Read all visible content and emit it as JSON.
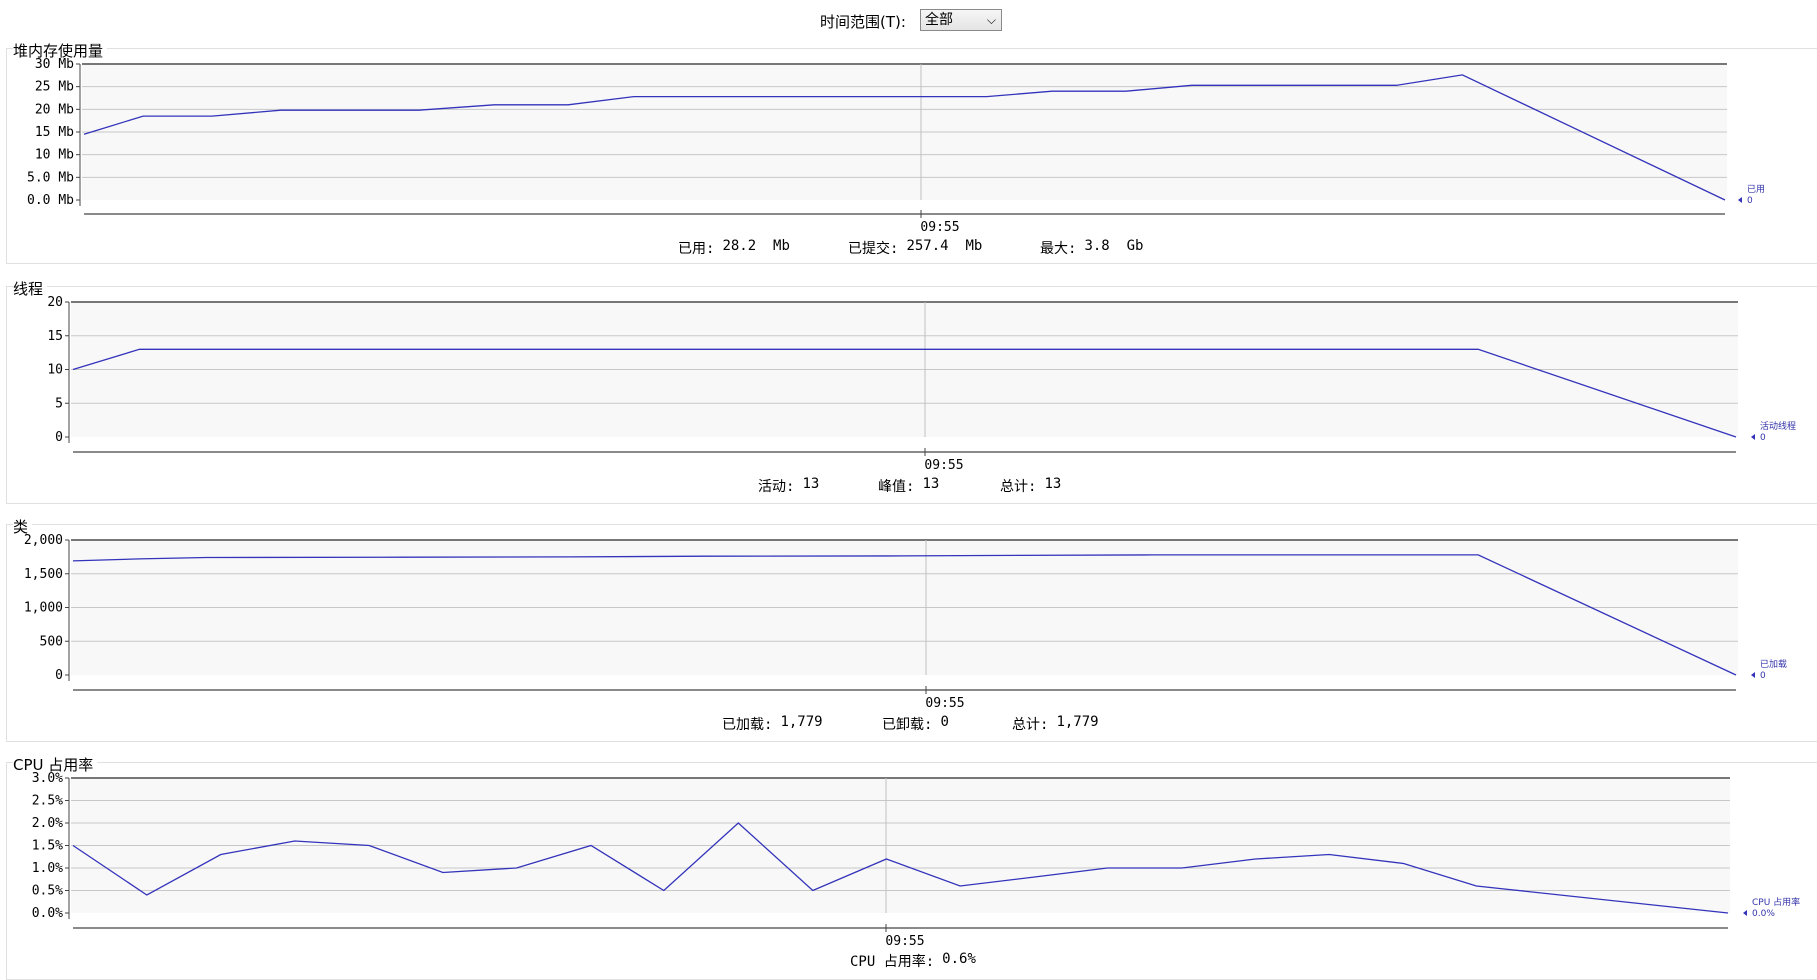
{
  "toolbar": {
    "range_label": "时间范围(T):",
    "range_value": "全部"
  },
  "panels": [
    {
      "title": "堆内存使用量",
      "legend_name": "已用",
      "legend_value": "0",
      "time_label": "09:55",
      "stats": [
        {
          "label": "已用:",
          "value": "28.2  Mb"
        },
        {
          "label": "已提交:",
          "value": "257.4  Mb"
        },
        {
          "label": "最大:",
          "value": "3.8  Gb"
        }
      ]
    },
    {
      "title": "线程",
      "legend_name": "活动线程",
      "legend_value": "0",
      "time_label": "09:55",
      "stats": [
        {
          "label": "活动:",
          "value": "13"
        },
        {
          "label": "峰值:",
          "value": "13"
        },
        {
          "label": "总计:",
          "value": "13"
        }
      ]
    },
    {
      "title": "类",
      "legend_name": "已加载",
      "legend_value": "0",
      "time_label": "09:55",
      "stats": [
        {
          "label": "已加载:",
          "value": "1,779"
        },
        {
          "label": "已卸载:",
          "value": "0"
        },
        {
          "label": "总计:",
          "value": "1,779"
        }
      ]
    },
    {
      "title": "CPU 占用率",
      "legend_name": "CPU 占用率",
      "legend_value": "0.0%",
      "time_label": "09:55",
      "stats": [
        {
          "label": "CPU 占用率:",
          "value": "0.6%"
        }
      ]
    }
  ],
  "colors": {
    "series": "#3333bb",
    "grid": "#c8c8c8",
    "plot_bg": "#f8f8f8",
    "axis": "#444444"
  },
  "chart_data": [
    {
      "type": "line",
      "title": "堆内存使用量",
      "y_ticks": [
        "30 Mb",
        "25 Mb",
        "20 Mb",
        "15 Mb",
        "10 Mb",
        "5.0 Mb",
        "0.0 Mb"
      ],
      "ylim": [
        0,
        30
      ],
      "series": [
        {
          "name": "已用",
          "values": [
            14.5,
            18.5,
            18.5,
            19.8,
            19.8,
            19.8,
            21.0,
            21.0,
            22.8,
            22.8,
            22.8,
            22.8,
            22.8,
            22.8,
            24.0,
            24.0,
            25.3,
            25.3,
            25.3,
            25.3,
            27.6,
            0
          ]
        }
      ],
      "x_positions": [
        0,
        0.036,
        0.078,
        0.12,
        0.162,
        0.204,
        0.25,
        0.295,
        0.335,
        0.38,
        0.42,
        0.47,
        0.52,
        0.55,
        0.59,
        0.635,
        0.675,
        0.72,
        0.76,
        0.8,
        0.84,
        1.0
      ],
      "time_tick": "09:55"
    },
    {
      "type": "line",
      "title": "线程",
      "y_ticks": [
        "20",
        "15",
        "10",
        "5",
        "0"
      ],
      "ylim": [
        0,
        20
      ],
      "series": [
        {
          "name": "活动线程",
          "values": [
            10,
            13,
            13,
            13,
            13,
            13,
            0
          ]
        }
      ],
      "x_positions": [
        0,
        0.04,
        0.2,
        0.5,
        0.7,
        0.845,
        1.0
      ],
      "time_tick": "09:55"
    },
    {
      "type": "line",
      "title": "类",
      "y_ticks": [
        "2,000",
        "1,500",
        "1,000",
        "500",
        "0"
      ],
      "ylim": [
        0,
        2000
      ],
      "series": [
        {
          "name": "已加载",
          "values": [
            1690,
            1720,
            1740,
            1745,
            1750,
            1760,
            1765,
            1770,
            1779,
            1779,
            0
          ]
        }
      ],
      "x_positions": [
        0,
        0.04,
        0.08,
        0.2,
        0.3,
        0.38,
        0.5,
        0.55,
        0.65,
        0.845,
        1.0
      ],
      "time_tick": "09:55"
    },
    {
      "type": "line",
      "title": "CPU 占用率",
      "y_ticks": [
        "3.0%",
        "2.5%",
        "2.0%",
        "1.5%",
        "1.0%",
        "0.5%",
        "0.0%"
      ],
      "ylim": [
        0,
        3
      ],
      "series": [
        {
          "name": "CPU 占用率",
          "values": [
            1.5,
            0.4,
            1.3,
            1.6,
            1.5,
            0.9,
            1.0,
            1.5,
            0.5,
            2.0,
            0.5,
            1.2,
            0.6,
            0.8,
            1.0,
            1.0,
            1.2,
            1.3,
            1.1,
            0.6,
            0.0
          ]
        }
      ],
      "x_positions": [
        0,
        0.0446,
        0.0893,
        0.134,
        0.179,
        0.2235,
        0.268,
        0.313,
        0.357,
        0.402,
        0.447,
        0.4915,
        0.536,
        0.581,
        0.625,
        0.67,
        0.7145,
        0.759,
        0.804,
        0.848,
        1.0
      ],
      "time_tick": "09:55"
    }
  ]
}
